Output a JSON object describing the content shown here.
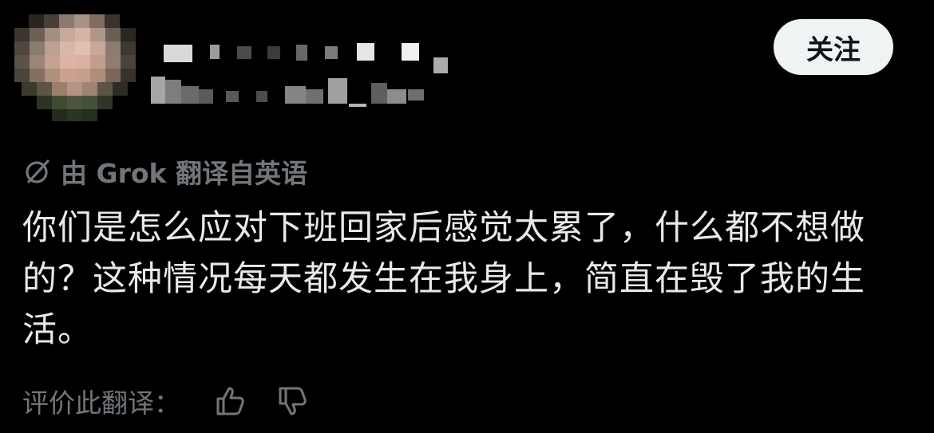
{
  "user": {
    "avatar_icon": "blurred-avatar-icon",
    "display_name_icon": "blurred-name-icon",
    "handle_icon": "blurred-handle-icon"
  },
  "follow_button": {
    "label": "关注"
  },
  "translation_note": {
    "icon": "grok-slash-circle-icon",
    "text": "由 Grok 翻译自英语"
  },
  "post": {
    "text": "你们是怎么应对下班回家后感觉太累了，什么都不想做的？这种情况每天都发生在我身上，简直在毁了我的生活。"
  },
  "rating": {
    "label": "评价此翻译：",
    "thumbs_up_icon": "thumbs-up-icon",
    "thumbs_down_icon": "thumbs-down-icon"
  },
  "colors": {
    "background": "#000000",
    "text_primary": "#e7e9ea",
    "text_secondary": "#71767b",
    "button_bg": "#eff3f4",
    "button_text": "#0f1419"
  }
}
